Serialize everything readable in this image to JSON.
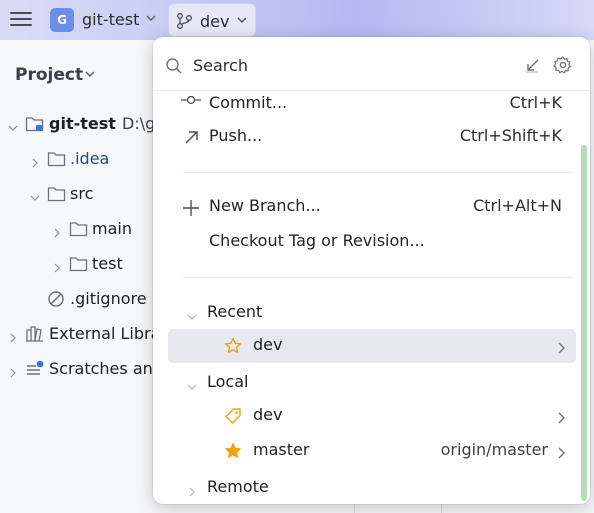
{
  "titlebar": {
    "project_badge": "G",
    "project_name": "git-test",
    "branch_name": "dev"
  },
  "project_panel": {
    "title": "Project",
    "tree": [
      {
        "label": "git-test",
        "suffix": "D:\\g"
      },
      {
        "label": ".idea"
      },
      {
        "label": "src"
      },
      {
        "label": "main"
      },
      {
        "label": "test"
      },
      {
        "label": ".gitignore"
      },
      {
        "label": "External Libra"
      },
      {
        "label": "Scratches and"
      }
    ]
  },
  "popup": {
    "search_placeholder": "Search",
    "actions": [
      {
        "label": "Commit...",
        "shortcut": "Ctrl+K",
        "icon": "commit-icon"
      },
      {
        "label": "Push...",
        "shortcut": "Ctrl+Shift+K",
        "icon": "push-arrow-icon"
      },
      {
        "label": "New Branch...",
        "shortcut": "Ctrl+Alt+N",
        "icon": "plus-icon"
      },
      {
        "label": "Checkout Tag or Revision...",
        "shortcut": "",
        "icon": ""
      }
    ],
    "groups": {
      "recent": {
        "label": "Recent",
        "branches": [
          {
            "name": "dev",
            "tracking": "",
            "icon": "star-outline-icon"
          }
        ]
      },
      "local": {
        "label": "Local",
        "branches": [
          {
            "name": "dev",
            "tracking": "",
            "icon": "tag-icon"
          },
          {
            "name": "master",
            "tracking": "origin/master",
            "icon": "star-filled-icon"
          }
        ]
      },
      "remote": {
        "label": "Remote"
      }
    }
  },
  "colors": {
    "accent_star": "#f0a30a",
    "selected_row": "#e8e9ee",
    "project_badge": "#6c8ee8",
    "scrollbar": "#b5dbb8"
  }
}
